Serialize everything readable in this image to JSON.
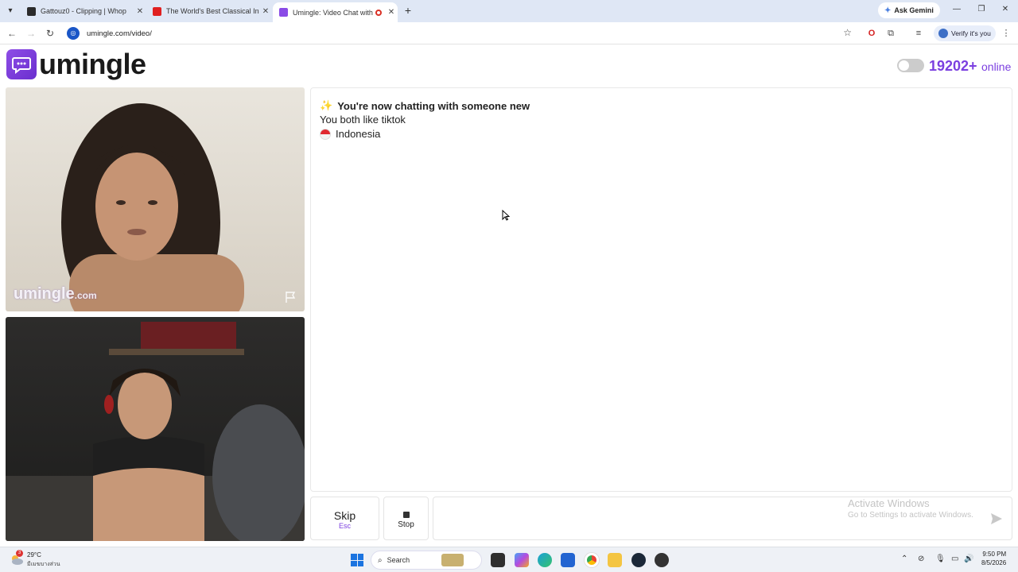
{
  "browser": {
    "tabs": [
      {
        "title": "Gattouz0 - Clipping | Whop",
        "favicon_color": "#2b2b2b"
      },
      {
        "title": "The World's Best Classical Instru",
        "favicon_color": "#e02020"
      },
      {
        "title": "Umingle: Video Chat with S",
        "favicon_color": "#8a4be6"
      }
    ],
    "ask_gemini": "Ask Gemini",
    "url": "umingle.com/video/",
    "verify_label": "Verify it's you"
  },
  "site": {
    "logo_text": "umingle",
    "online_count": "19202+",
    "online_label": "online",
    "accent_color": "#7b3fe0"
  },
  "video": {
    "watermark_main": "umingle",
    "watermark_suffix": ".com"
  },
  "chat": {
    "header": "You're now chatting with someone new",
    "interest": "You both like tiktok",
    "country": "Indonesia"
  },
  "controls": {
    "skip_label": "Skip",
    "skip_hint": "Esc",
    "stop_label": "Stop"
  },
  "windows_watermark": {
    "title": "Activate Windows",
    "subtitle": "Go to Settings to activate Windows."
  },
  "taskbar": {
    "weather_badge": "3",
    "temperature": "29°C",
    "weather_desc": "มีเมฆบางส่วน",
    "search_label": "Search",
    "time": "9:50 PM",
    "date": "8/5/2026"
  }
}
